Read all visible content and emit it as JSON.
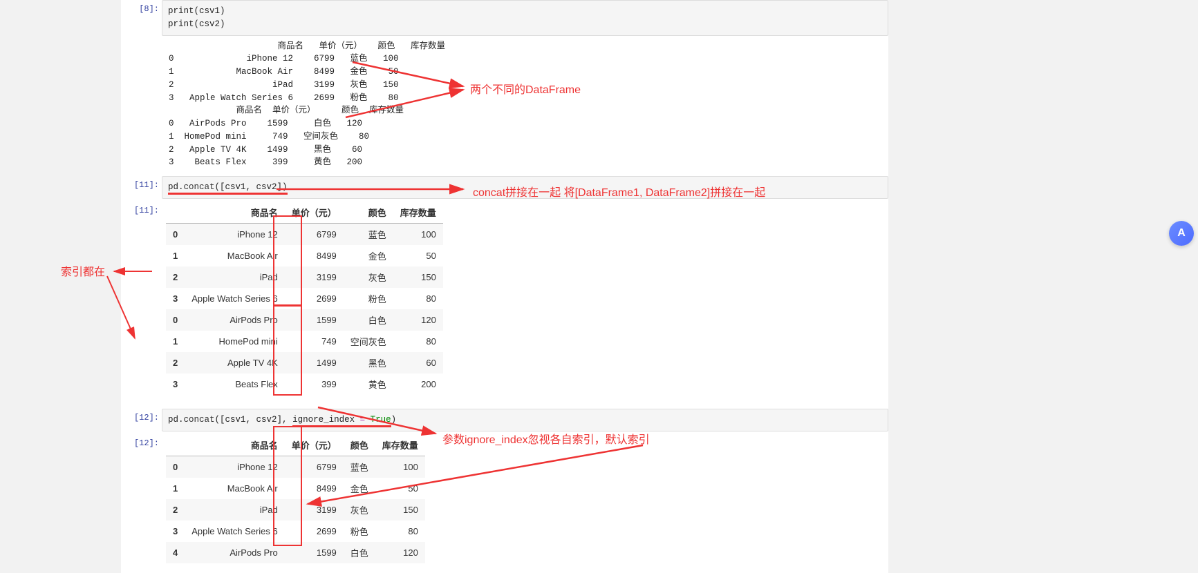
{
  "floating_button": {
    "label": "A"
  },
  "annotations": {
    "two_df": "两个不同的DataFrame",
    "concat_desc": "concat拼接在一起 将[DataFrame1, DataFrame2]拼接在一起",
    "index_preserved": "索引都在",
    "ignore_index_desc": "参数ignore_index忽视各自索引，默认索引"
  },
  "cells": {
    "c8": {
      "prompt": "[8]:",
      "code": "print(csv1)\nprint(csv2)",
      "output": "                     商品名   单价（元）   颜色   库存数量\n0              iPhone 12    6799   蓝色   100\n1            MacBook Air    8499   金色    50\n2                   iPad    3199   灰色   150\n3   Apple Watch Series 6    2699   粉色    80\n             商品名  单价（元）     颜色  库存数量\n0   AirPods Pro    1599     白色   120\n1  HomePod mini     749   空间灰色    80\n2   Apple TV 4K    1499     黑色    60\n3    Beats Flex     399     黄色   200"
    },
    "c11_in": {
      "prompt": "[11]:",
      "code_parts": {
        "pre": "pd.",
        "fn": "concat",
        "args": "([csv1, csv2])"
      }
    },
    "c11_out": {
      "prompt": "[11]:",
      "headers": [
        "",
        "商品名",
        "单价（元）",
        "颜色",
        "库存数量"
      ],
      "rows": [
        {
          "idx": "0",
          "cells": [
            "iPhone 12",
            "6799",
            "蓝色",
            "100"
          ]
        },
        {
          "idx": "1",
          "cells": [
            "MacBook Air",
            "8499",
            "金色",
            "50"
          ]
        },
        {
          "idx": "2",
          "cells": [
            "iPad",
            "3199",
            "灰色",
            "150"
          ]
        },
        {
          "idx": "3",
          "cells": [
            "Apple Watch Series 6",
            "2699",
            "粉色",
            "80"
          ]
        },
        {
          "idx": "0",
          "cells": [
            "AirPods Pro",
            "1599",
            "白色",
            "120"
          ]
        },
        {
          "idx": "1",
          "cells": [
            "HomePod mini",
            "749",
            "空间灰色",
            "80"
          ]
        },
        {
          "idx": "2",
          "cells": [
            "Apple TV 4K",
            "1499",
            "黑色",
            "60"
          ]
        },
        {
          "idx": "3",
          "cells": [
            "Beats Flex",
            "399",
            "黄色",
            "200"
          ]
        }
      ]
    },
    "c12_in": {
      "prompt": "[12]:",
      "code_parts": {
        "pre": "pd.",
        "fn": "concat",
        "args1": "([csv1, csv2], ",
        "kw": "ignore_index",
        "eq": " = ",
        "val": "True",
        "close": ")"
      }
    },
    "c12_out": {
      "prompt": "[12]:",
      "headers": [
        "",
        "商品名",
        "单价（元）",
        "颜色",
        "库存数量"
      ],
      "rows": [
        {
          "idx": "0",
          "cells": [
            "iPhone 12",
            "6799",
            "蓝色",
            "100"
          ]
        },
        {
          "idx": "1",
          "cells": [
            "MacBook Air",
            "8499",
            "金色",
            "50"
          ]
        },
        {
          "idx": "2",
          "cells": [
            "iPad",
            "3199",
            "灰色",
            "150"
          ]
        },
        {
          "idx": "3",
          "cells": [
            "Apple Watch Series 6",
            "2699",
            "粉色",
            "80"
          ]
        },
        {
          "idx": "4",
          "cells": [
            "AirPods Pro",
            "1599",
            "白色",
            "120"
          ]
        }
      ]
    }
  }
}
